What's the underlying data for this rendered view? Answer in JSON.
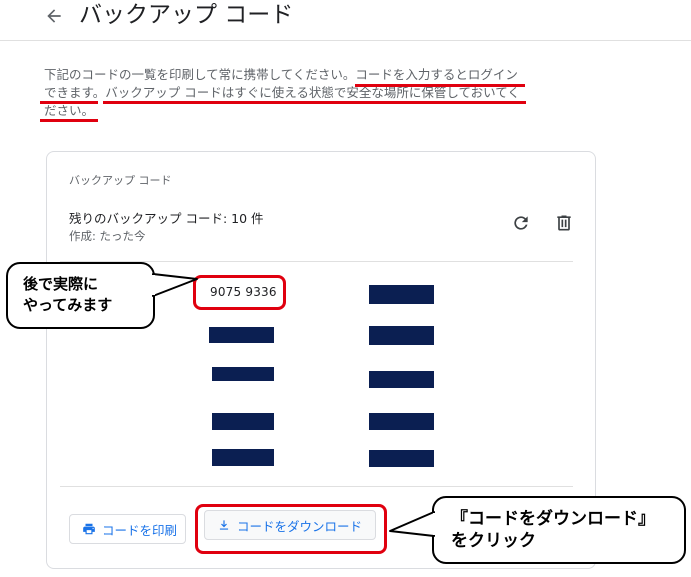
{
  "header": {
    "title": "バックアップ コード",
    "back_icon": "arrow-left-icon"
  },
  "description": {
    "line1": "下記のコードの一覧を印刷して常に携帯してください。コードを入力するとログイン",
    "line2": "できます。バックアップ コードはすぐに使える状態で安全な場所に保管しておいてく",
    "line3": "ださい。"
  },
  "card": {
    "label": "バックアップ コード",
    "remaining": "残りのバックアップ コード: 10 件",
    "created": "作成: たった今",
    "refresh_icon": "refresh-icon",
    "delete_icon": "trash-icon"
  },
  "codes": {
    "first_code": "9075 9336"
  },
  "buttons": {
    "print_label": "コードを印刷",
    "download_label": "コードをダウンロード",
    "print_icon": "printer-icon",
    "download_icon": "download-icon"
  },
  "annotations": {
    "left_line1": "後で実際に",
    "left_line2": "やってみます",
    "right_line1": "『コードをダウンロード』",
    "right_line2": "をクリック"
  },
  "colors": {
    "accent": "#1a73e8",
    "highlight": "#e0000f",
    "mask": "#0b1f52"
  }
}
